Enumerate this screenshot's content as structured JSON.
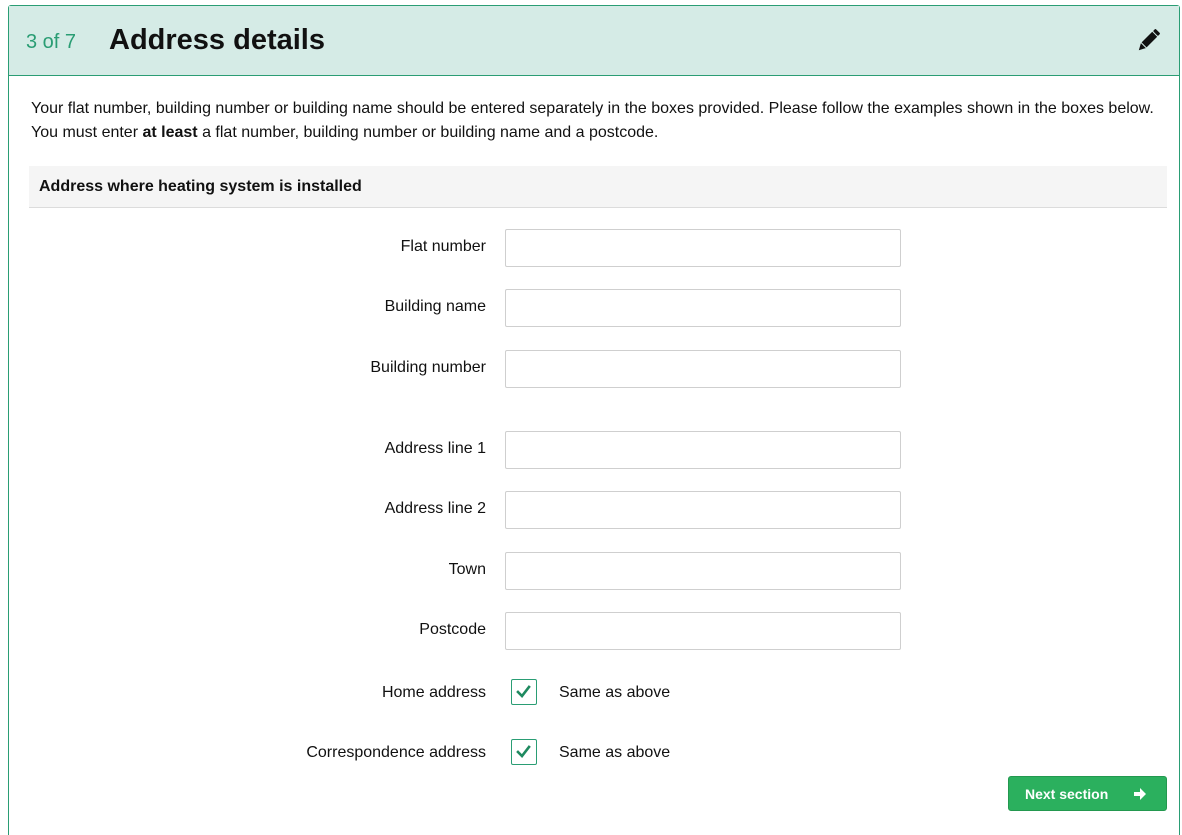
{
  "header": {
    "step": "3 of 7",
    "title": "Address details",
    "edit_icon": "pencil-icon"
  },
  "intro": {
    "part1": "Your flat number, building number or building name should be entered separately in the boxes provided. Please follow the examples shown in the boxes below. You must enter ",
    "emphasis": "at least",
    "part2": " a flat number, building number or building name and a postcode."
  },
  "section": {
    "title": "Address where heating system is installed"
  },
  "fields": {
    "flat_number": {
      "label": "Flat number",
      "value": "",
      "placeholder": ""
    },
    "building_name": {
      "label": "Building name",
      "value": "",
      "placeholder": ""
    },
    "building_number": {
      "label": "Building number",
      "value": "",
      "placeholder": ""
    },
    "address_line_1": {
      "label": "Address line 1",
      "value": "",
      "placeholder": ""
    },
    "address_line_2": {
      "label": "Address line 2",
      "value": "",
      "placeholder": ""
    },
    "town": {
      "label": "Town",
      "value": "",
      "placeholder": ""
    },
    "postcode": {
      "label": "Postcode",
      "value": "",
      "placeholder": ""
    }
  },
  "checkboxes": {
    "home_address": {
      "label": "Home address",
      "option": "Same as above",
      "checked": true
    },
    "correspondence_address": {
      "label": "Correspondence address",
      "option": "Same as above",
      "checked": true
    }
  },
  "actions": {
    "next_label": "Next section",
    "next_icon": "arrow-right-icon"
  },
  "colors": {
    "accent": "#2a9d74",
    "header_bg": "#d5ebe6",
    "button_bg": "#2bb05e"
  }
}
